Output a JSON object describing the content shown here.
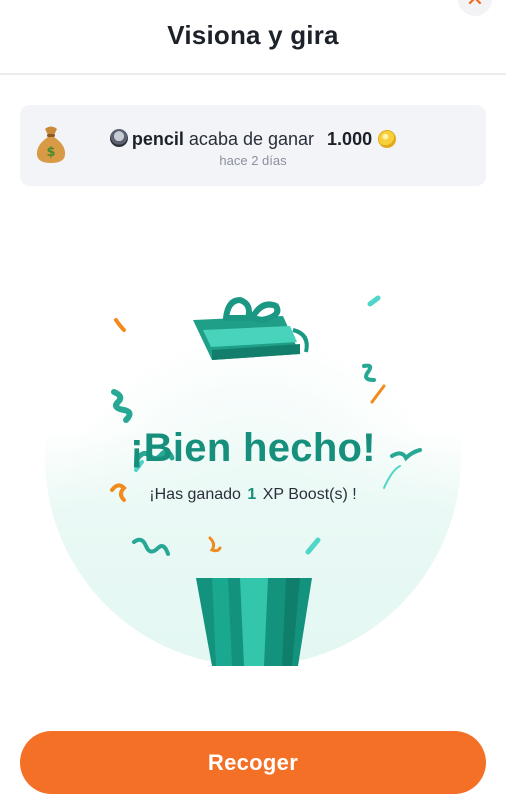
{
  "header": {
    "title": "Visiona y gira",
    "close_icon": "close-icon"
  },
  "ticker": {
    "icon": "money-bag-icon",
    "avatar": "user-avatar",
    "username": "pencil",
    "message": "acaba de ganar",
    "amount": "1.000",
    "currency_icon": "coin-icon",
    "time": "hace 2 días"
  },
  "reward": {
    "headline": "¡Bien hecho!",
    "sub_prefix": "¡Has ganado",
    "count": "1",
    "sub_suffix": "XP Boost(s) !",
    "gift_icon": "gift-box-icon"
  },
  "actions": {
    "collect_label": "Recoger"
  },
  "colors": {
    "accent_teal": "#16907c",
    "button_orange": "#f57027",
    "confetti_orange": "#f28b1e",
    "confetti_cyan": "#4fd6c8"
  }
}
